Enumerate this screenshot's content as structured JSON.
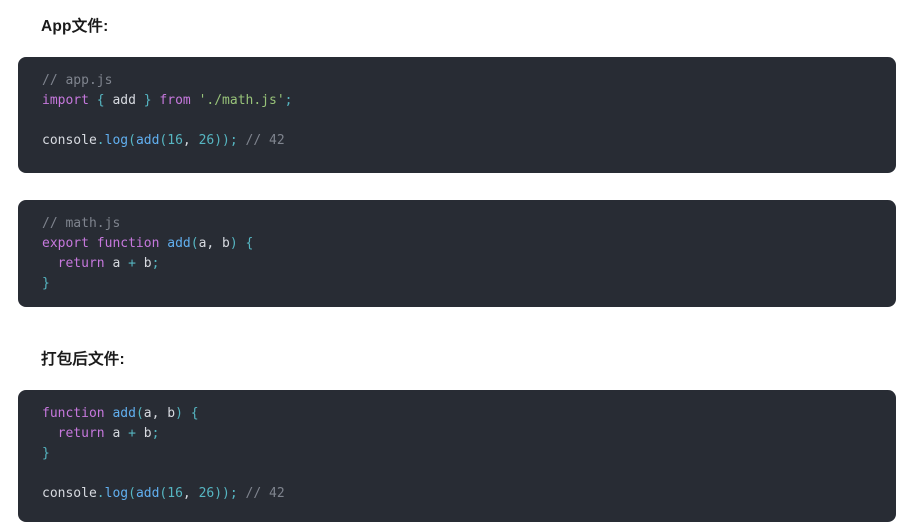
{
  "headings": {
    "app": "App文件:",
    "bundle": "打包后文件:"
  },
  "colors": {
    "page_background": "#ffffff",
    "code_background": "#282c34",
    "heading_text": "#1a1a1a",
    "comment": "#7f848e",
    "keyword": "#c678dd",
    "string": "#98c379",
    "function": "#61afef",
    "number": "#56b6c2",
    "punctuation": "#56b6c2",
    "plain_text": "#d7dae0"
  },
  "code_blocks": [
    {
      "id": "app",
      "language": "javascript",
      "lines": [
        {
          "tokens": [
            {
              "text": "// app.js",
              "type": "comment"
            }
          ]
        },
        {
          "tokens": [
            {
              "text": "import",
              "type": "keyword"
            },
            {
              "text": " ",
              "type": "plain"
            },
            {
              "text": "{",
              "type": "punct"
            },
            {
              "text": " ",
              "type": "plain"
            },
            {
              "text": "add",
              "type": "plain"
            },
            {
              "text": " ",
              "type": "plain"
            },
            {
              "text": "}",
              "type": "punct"
            },
            {
              "text": " ",
              "type": "plain"
            },
            {
              "text": "from",
              "type": "keyword"
            },
            {
              "text": " ",
              "type": "plain"
            },
            {
              "text": "'./math.js'",
              "type": "string"
            },
            {
              "text": ";",
              "type": "punct"
            }
          ]
        },
        {
          "tokens": [
            {
              "text": "",
              "type": "plain"
            }
          ]
        },
        {
          "tokens": [
            {
              "text": "console",
              "type": "plain"
            },
            {
              "text": ".",
              "type": "punct"
            },
            {
              "text": "log",
              "type": "prop"
            },
            {
              "text": "(",
              "type": "punct"
            },
            {
              "text": "add",
              "type": "func"
            },
            {
              "text": "(",
              "type": "punct"
            },
            {
              "text": "16",
              "type": "number"
            },
            {
              "text": ", ",
              "type": "plain"
            },
            {
              "text": "26",
              "type": "number"
            },
            {
              "text": "));",
              "type": "punct"
            },
            {
              "text": " ",
              "type": "plain"
            },
            {
              "text": "// 42",
              "type": "comment"
            }
          ]
        }
      ]
    },
    {
      "id": "math",
      "language": "javascript",
      "lines": [
        {
          "tokens": [
            {
              "text": "// math.js",
              "type": "comment"
            }
          ]
        },
        {
          "tokens": [
            {
              "text": "export",
              "type": "keyword"
            },
            {
              "text": " ",
              "type": "plain"
            },
            {
              "text": "function",
              "type": "keyword"
            },
            {
              "text": " ",
              "type": "plain"
            },
            {
              "text": "add",
              "type": "func"
            },
            {
              "text": "(",
              "type": "punct"
            },
            {
              "text": "a",
              "type": "plain"
            },
            {
              "text": ", ",
              "type": "plain"
            },
            {
              "text": "b",
              "type": "plain"
            },
            {
              "text": ")",
              "type": "punct"
            },
            {
              "text": " ",
              "type": "plain"
            },
            {
              "text": "{",
              "type": "punct"
            }
          ]
        },
        {
          "tokens": [
            {
              "text": "  ",
              "type": "plain"
            },
            {
              "text": "return",
              "type": "keyword"
            },
            {
              "text": " ",
              "type": "plain"
            },
            {
              "text": "a",
              "type": "plain"
            },
            {
              "text": " ",
              "type": "plain"
            },
            {
              "text": "+",
              "type": "punct"
            },
            {
              "text": " ",
              "type": "plain"
            },
            {
              "text": "b",
              "type": "plain"
            },
            {
              "text": ";",
              "type": "punct"
            }
          ]
        },
        {
          "tokens": [
            {
              "text": "}",
              "type": "punct"
            }
          ]
        }
      ]
    },
    {
      "id": "bundle",
      "language": "javascript",
      "lines": [
        {
          "tokens": [
            {
              "text": "function",
              "type": "keyword"
            },
            {
              "text": " ",
              "type": "plain"
            },
            {
              "text": "add",
              "type": "func"
            },
            {
              "text": "(",
              "type": "punct"
            },
            {
              "text": "a",
              "type": "plain"
            },
            {
              "text": ", ",
              "type": "plain"
            },
            {
              "text": "b",
              "type": "plain"
            },
            {
              "text": ")",
              "type": "punct"
            },
            {
              "text": " ",
              "type": "plain"
            },
            {
              "text": "{",
              "type": "punct"
            }
          ]
        },
        {
          "tokens": [
            {
              "text": "  ",
              "type": "plain"
            },
            {
              "text": "return",
              "type": "keyword"
            },
            {
              "text": " ",
              "type": "plain"
            },
            {
              "text": "a",
              "type": "plain"
            },
            {
              "text": " ",
              "type": "plain"
            },
            {
              "text": "+",
              "type": "punct"
            },
            {
              "text": " ",
              "type": "plain"
            },
            {
              "text": "b",
              "type": "plain"
            },
            {
              "text": ";",
              "type": "punct"
            }
          ]
        },
        {
          "tokens": [
            {
              "text": "}",
              "type": "punct"
            }
          ]
        },
        {
          "tokens": [
            {
              "text": "",
              "type": "plain"
            }
          ]
        },
        {
          "tokens": [
            {
              "text": "console",
              "type": "plain"
            },
            {
              "text": ".",
              "type": "punct"
            },
            {
              "text": "log",
              "type": "prop"
            },
            {
              "text": "(",
              "type": "punct"
            },
            {
              "text": "add",
              "type": "func"
            },
            {
              "text": "(",
              "type": "punct"
            },
            {
              "text": "16",
              "type": "number"
            },
            {
              "text": ", ",
              "type": "plain"
            },
            {
              "text": "26",
              "type": "number"
            },
            {
              "text": "));",
              "type": "punct"
            },
            {
              "text": " ",
              "type": "plain"
            },
            {
              "text": "// 42",
              "type": "comment"
            }
          ]
        }
      ]
    }
  ]
}
